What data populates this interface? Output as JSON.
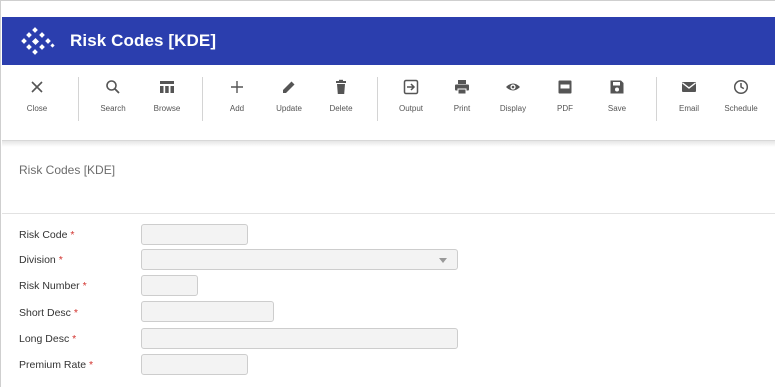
{
  "window": {
    "title": "Risk Codes [KDE]"
  },
  "toolbar": [
    {
      "key": "close",
      "label": "Close"
    },
    {
      "key": "search",
      "label": "Search"
    },
    {
      "key": "browse",
      "label": "Browse"
    },
    {
      "key": "add",
      "label": "Add"
    },
    {
      "key": "update",
      "label": "Update"
    },
    {
      "key": "delete",
      "label": "Delete"
    },
    {
      "key": "output",
      "label": "Output"
    },
    {
      "key": "print",
      "label": "Print"
    },
    {
      "key": "display",
      "label": "Display"
    },
    {
      "key": "pdf",
      "label": "PDF"
    },
    {
      "key": "save",
      "label": "Save"
    },
    {
      "key": "email",
      "label": "Email"
    },
    {
      "key": "schedule",
      "label": "Schedule"
    }
  ],
  "form": {
    "heading": "Risk Codes [KDE]",
    "required_marker": "*",
    "fields": [
      {
        "label": "Risk Code",
        "value": ""
      },
      {
        "label": "Division",
        "value": "",
        "type": "select"
      },
      {
        "label": "Risk Number",
        "value": ""
      },
      {
        "label": "Short Desc",
        "value": ""
      },
      {
        "label": "Long Desc",
        "value": ""
      },
      {
        "label": "Premium Rate",
        "value": ""
      }
    ]
  },
  "colors": {
    "titlebar": "#2b3eae",
    "required": "#d2322d"
  },
  "icons": [
    "logo-icon",
    "close-icon",
    "search-icon",
    "browse-icon",
    "add-icon",
    "update-icon",
    "delete-icon",
    "output-icon",
    "print-icon",
    "display-icon",
    "pdf-icon",
    "save-icon",
    "email-icon",
    "schedule-icon"
  ]
}
